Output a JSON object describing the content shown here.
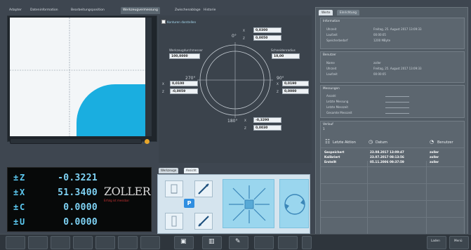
{
  "tabs": [
    "Adapter",
    "Dateninformation",
    "Bearbeitungsposition",
    "Werkzeugvermessung",
    "Zwischenablage",
    "Historie"
  ],
  "tabs_active_index": 3,
  "center": {
    "checkbox_label": "Konturen darstellen",
    "angle_top": "0°",
    "angle_left": "270°",
    "angle_right": "90°",
    "angle_bottom": "180°",
    "top_x_label": "X",
    "top_x_value": "0,0300",
    "top_z_label": "Z",
    "top_z_value": "0,0050",
    "left_field_label": "Werkzeugdurchmesser",
    "left_field_value": "100,0000",
    "right_field_label": "Schneidenradius",
    "right_field_value": "10,00",
    "left_x_label": "X",
    "left_x_value": "0,0100",
    "left_z_label": "Z",
    "left_z_value": "-0,0059",
    "right_x_label": "X",
    "right_x_value": "0,0190",
    "right_z_label": "Z",
    "right_z_value": "0,0000",
    "bottom_x_label": "X",
    "bottom_x_value": "-0,3290",
    "bottom_z_label": "Z",
    "bottom_z_value": "0,0030"
  },
  "dro": [
    {
      "axis": "Z",
      "value": "-0.3221"
    },
    {
      "axis": "X",
      "value": "51.3400"
    },
    {
      "axis": "C",
      "value": "0.0000"
    },
    {
      "axis": "U",
      "value": "0.0000"
    }
  ],
  "brand": {
    "name": "ZOLLER",
    "claim": "Erfolg ist messbar"
  },
  "bottom_tabs": [
    "Werkzeuge",
    "Ansicht"
  ],
  "bottom_tabs_active_index": 1,
  "p_badge": "P",
  "right": {
    "tabs": [
      "Werte",
      "Einrichtung"
    ],
    "tabs_active_index": 0,
    "group1": {
      "title": "Information",
      "rows": [
        {
          "label": "Uhrzeit",
          "value": "Freitag, 25. August 2017 13:09:33"
        },
        {
          "label": "Laufzeit",
          "value": "00:00:05"
        },
        {
          "label": "Speicherbedarf",
          "value": "1200 MByte"
        }
      ]
    },
    "group2": {
      "title": "Benutzer",
      "rows": [
        {
          "label": "Name",
          "value": "zoller"
        },
        {
          "label": "Uhrzeit",
          "value": "Freitag, 25. August 2017 13:09:33"
        },
        {
          "label": "Laufzeit",
          "value": "00:00:05"
        }
      ]
    },
    "group3": {
      "title": "Messungen",
      "rows": [
        "Anzahl",
        "Letzte Messung",
        "Letzte Messzeit",
        "Gesamte Messzeit"
      ]
    },
    "history": {
      "title": "Verlauf",
      "index": "1",
      "col_last": "Letzte Aktion",
      "col_date": "Datum",
      "col_user": "Benutzer",
      "rows": [
        {
          "action": "Gespeichert",
          "date": "23.08.2017 13:09:47",
          "user": "zoller"
        },
        {
          "action": "Kalibriert",
          "date": "23.07.2017 08:13:56",
          "user": "zoller"
        },
        {
          "action": "Erstellt",
          "date": "05.11.2006 09:37:59",
          "user": "zoller"
        }
      ]
    }
  },
  "bottombar": {
    "left_button": "Laden",
    "right_button": "Menü"
  }
}
